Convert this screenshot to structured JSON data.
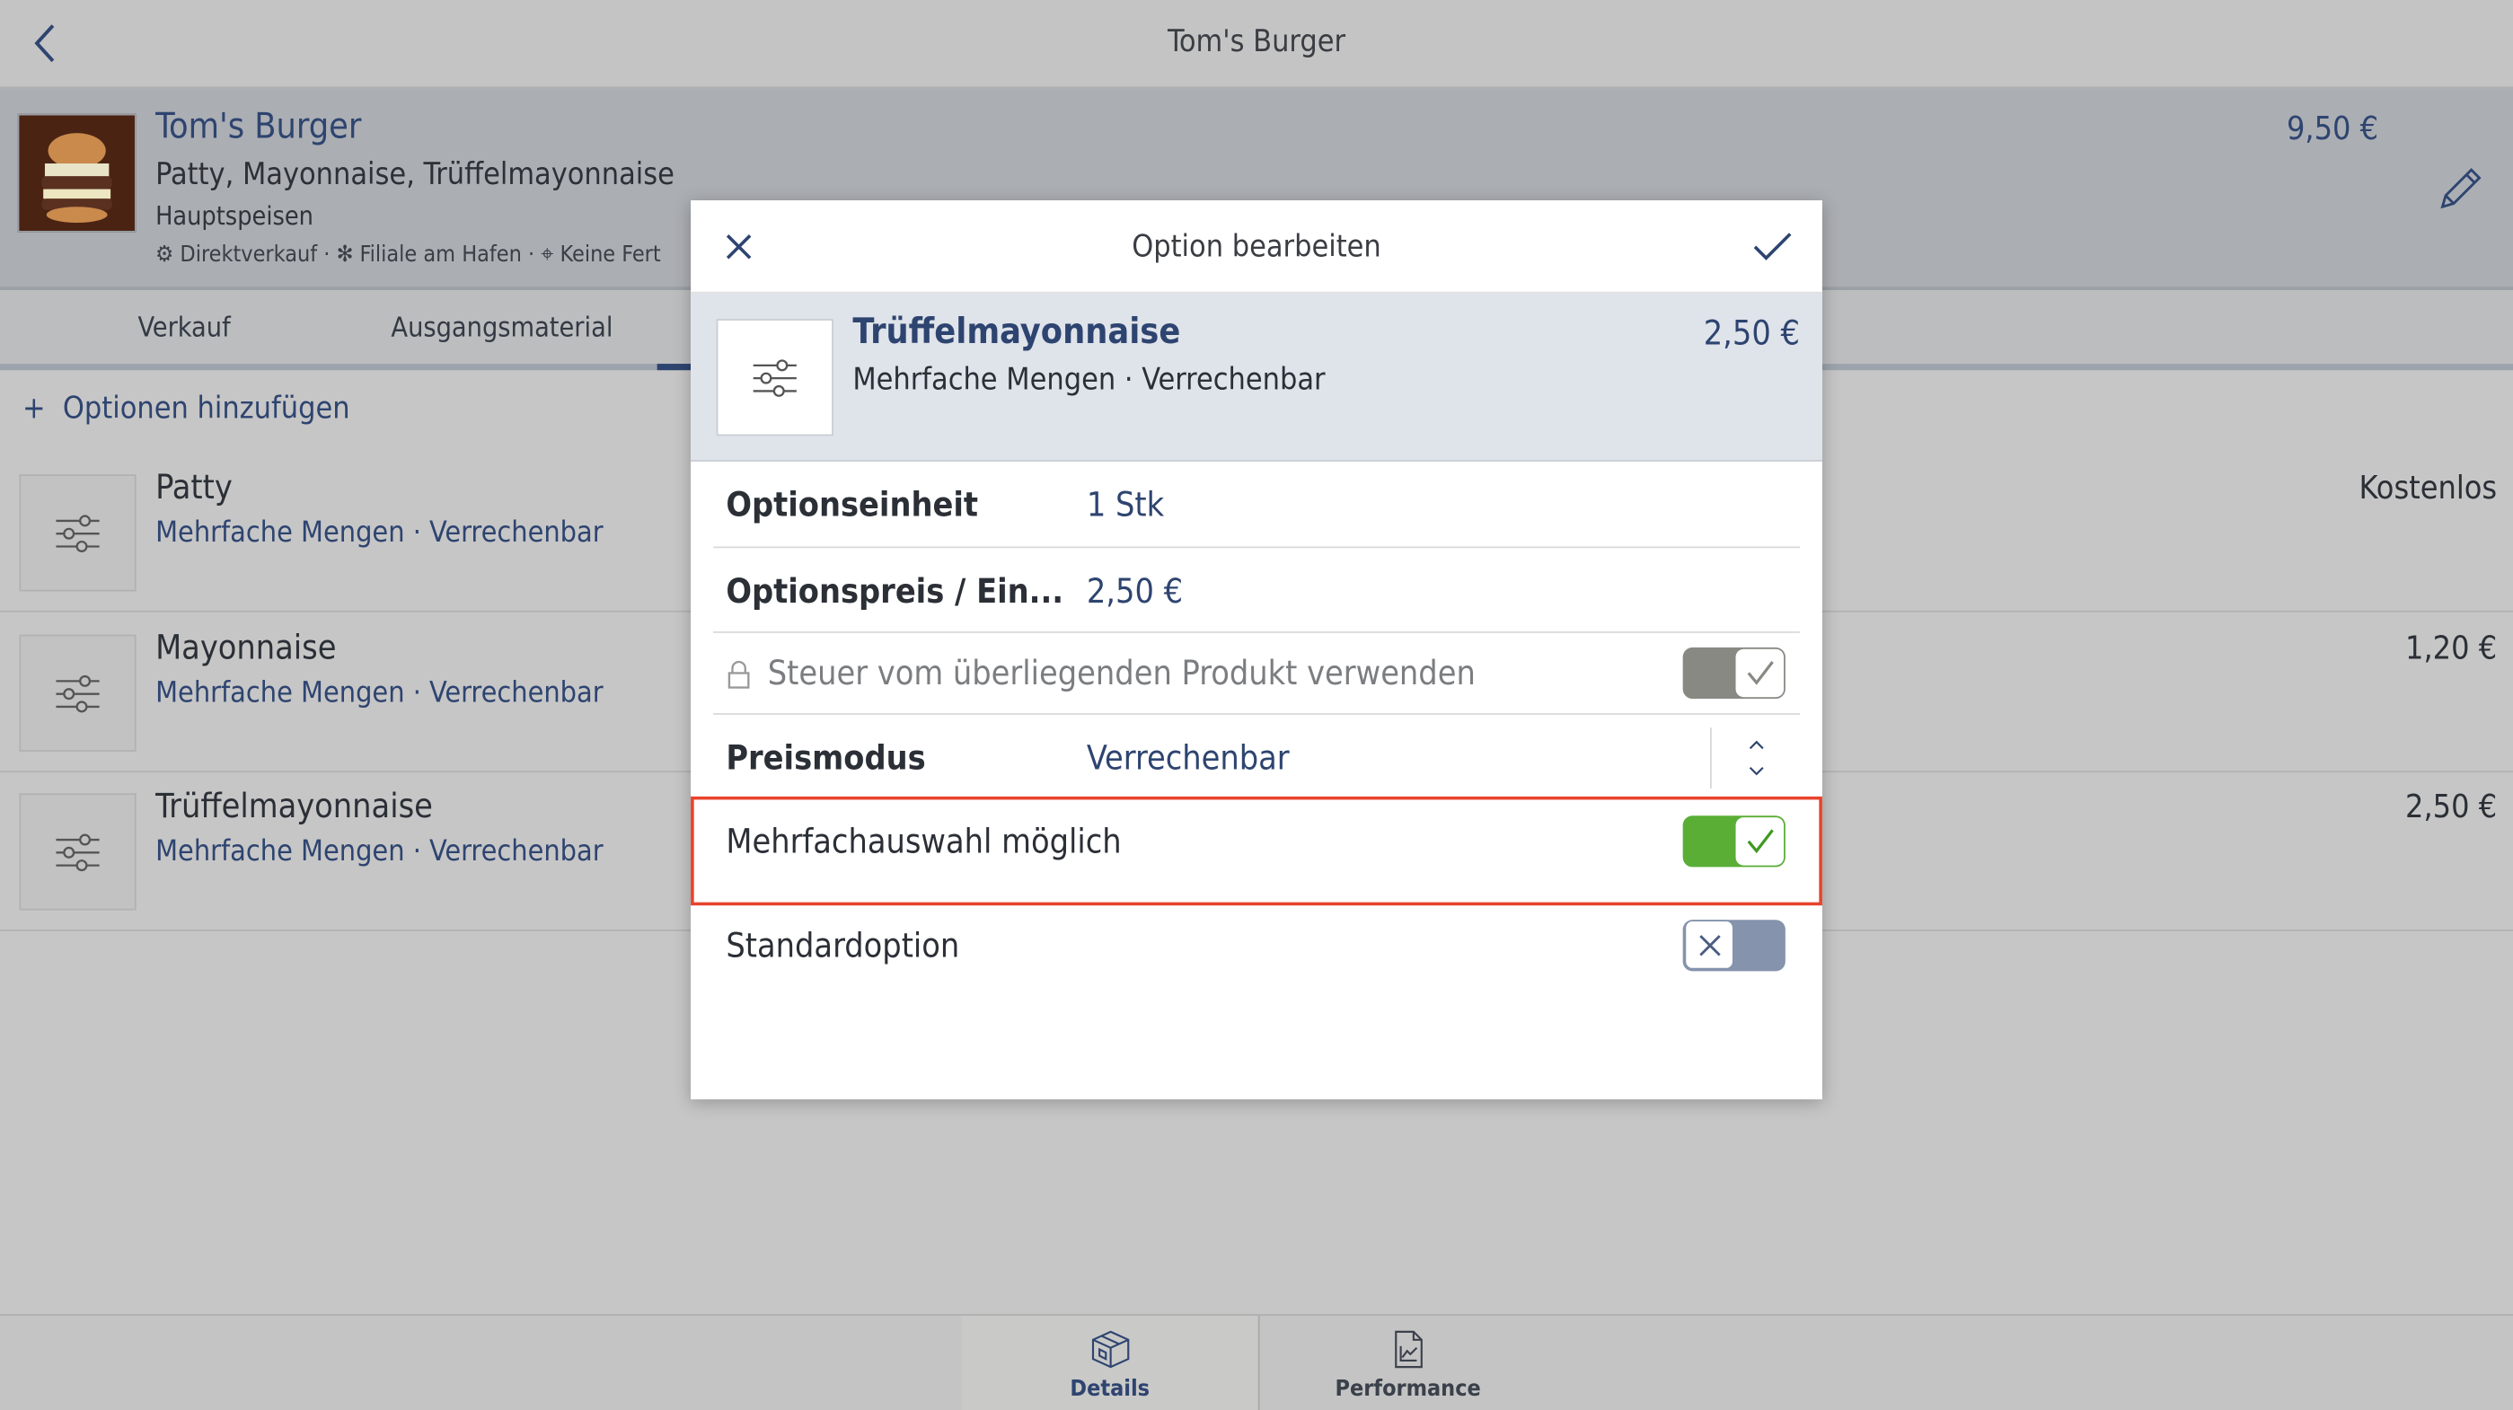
{
  "topbar": {
    "title": "Tom's Burger"
  },
  "product": {
    "name": "Tom's Burger",
    "ingredients": "Patty, Mayonnaise, Trüffelmayonnaise",
    "category": "Hauptspeisen",
    "meta": [
      "Direktverkauf",
      "Filiale am Hafen",
      "Keine Fert"
    ],
    "price": "9,50 €"
  },
  "tabs": [
    {
      "label": "Verkauf"
    },
    {
      "label": "Ausgangsmaterial"
    }
  ],
  "add_options_label": "Optionen hinzufügen",
  "options": [
    {
      "name": "Patty",
      "sub": "Mehrfache Mengen · Verrechenbar",
      "price": "Kostenlos"
    },
    {
      "name": "Mayonnaise",
      "sub": "Mehrfache Mengen · Verrechenbar",
      "price": "1,20 €"
    },
    {
      "name": "Trüffelmayonnaise",
      "sub": "Mehrfache Mengen · Verrechenbar",
      "price": "2,50 €"
    }
  ],
  "dialog": {
    "title": "Option bearbeiten",
    "item": {
      "name": "Trüffelmayonnaise",
      "sub": "Mehrfache Mengen · Verrechenbar",
      "price": "2,50 €"
    },
    "fields": {
      "unit_label": "Optionseinheit",
      "unit_value": "1 Stk",
      "price_label": "Optionspreis / Ein...",
      "price_value": "2,50 €",
      "tax_label": "Steuer vom überliegenden Produkt verwenden",
      "tax_on": true,
      "mode_label": "Preismodus",
      "mode_value": "Verrechenbar",
      "multi_label": "Mehrfachauswahl möglich",
      "multi_on": true,
      "default_label": "Standardoption",
      "default_on": false
    }
  },
  "bottom_tabs": [
    {
      "label": "Details",
      "active": true
    },
    {
      "label": "Performance",
      "active": false
    }
  ],
  "colors": {
    "accent": "#2e4470",
    "toggle_on": "#5aae36",
    "highlight": "#e8432c"
  }
}
